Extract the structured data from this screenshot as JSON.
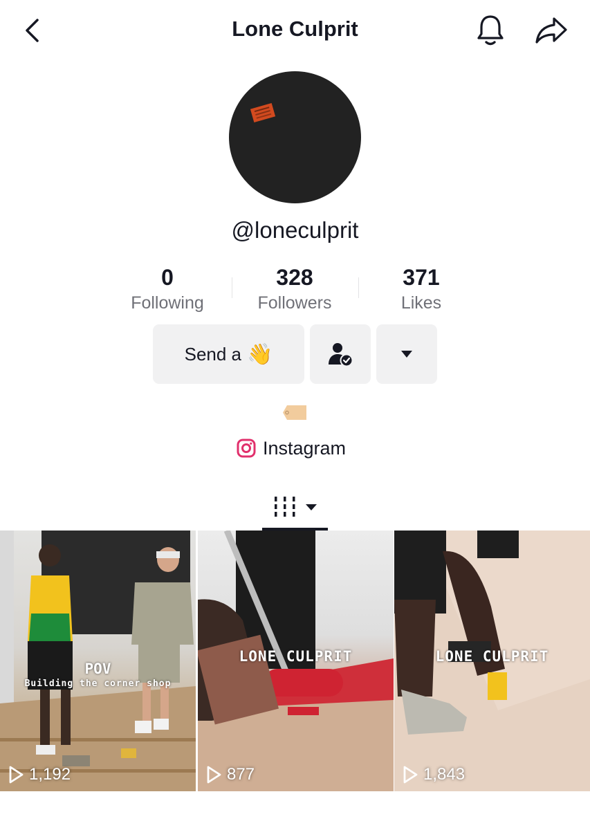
{
  "header": {
    "title": "Lone Culprit"
  },
  "profile": {
    "username": "@loneculprit",
    "avatar_tag_color": "#d24a1f"
  },
  "stats": {
    "following": {
      "value": "0",
      "label": "Following"
    },
    "followers": {
      "value": "328",
      "label": "Followers"
    },
    "likes": {
      "value": "371",
      "label": "Likes"
    }
  },
  "actions": {
    "send_label": "Send a",
    "send_emoji": "👋"
  },
  "links": {
    "instagram_label": "Instagram",
    "instagram_color": "#e1306c"
  },
  "videos": [
    {
      "views": "1,192",
      "overlay_title": "POV",
      "overlay_subtitle": "Building the corner shop"
    },
    {
      "views": "877",
      "overlay_title": "LONE CULPRIT"
    },
    {
      "views": "1,843",
      "overlay_title": "LONE CULPRIT"
    }
  ]
}
